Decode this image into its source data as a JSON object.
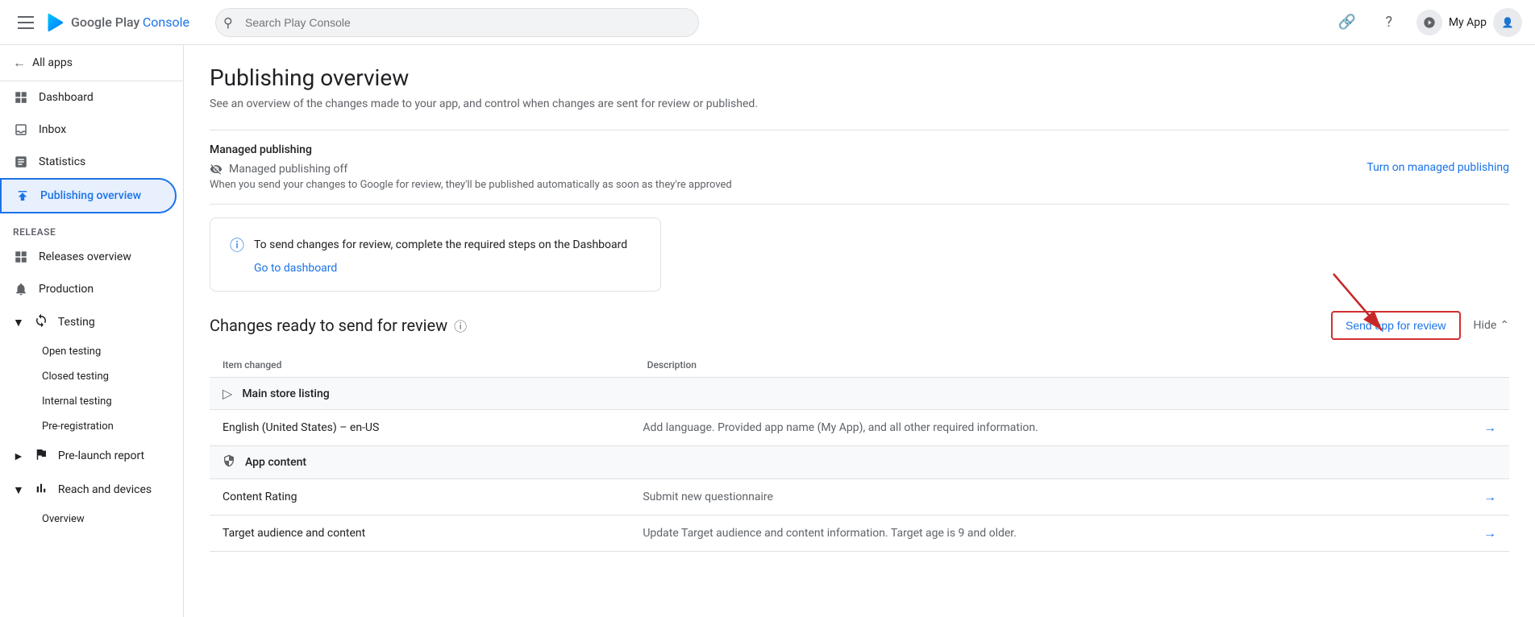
{
  "topbar": {
    "menu_label": "Menu",
    "logo_google": "Google Play",
    "logo_console": "Console",
    "search_placeholder": "Search Play Console",
    "link_icon": "🔗",
    "help_icon": "?",
    "app_name": "My App"
  },
  "sidebar": {
    "all_apps_label": "All apps",
    "nav_items": [
      {
        "id": "dashboard",
        "label": "Dashboard",
        "icon": "grid"
      },
      {
        "id": "inbox",
        "label": "Inbox",
        "icon": "inbox"
      },
      {
        "id": "statistics",
        "label": "Statistics",
        "icon": "bar-chart"
      },
      {
        "id": "publishing-overview",
        "label": "Publishing overview",
        "icon": "publish",
        "active": true
      }
    ],
    "release_section": "Release",
    "release_items": [
      {
        "id": "releases-overview",
        "label": "Releases overview",
        "icon": "grid"
      },
      {
        "id": "production",
        "label": "Production",
        "icon": "bell"
      },
      {
        "id": "testing",
        "label": "Testing",
        "icon": "refresh",
        "expandable": true,
        "expanded": true
      },
      {
        "id": "open-testing",
        "label": "Open testing",
        "sub": true
      },
      {
        "id": "closed-testing",
        "label": "Closed testing",
        "sub": true
      },
      {
        "id": "internal-testing",
        "label": "Internal testing",
        "sub": true
      },
      {
        "id": "pre-registration",
        "label": "Pre-registration",
        "sub": true
      },
      {
        "id": "pre-launch-report",
        "label": "Pre-launch report",
        "icon": "flag",
        "expandable": true
      },
      {
        "id": "reach-and-devices",
        "label": "Reach and devices",
        "icon": "bar-chart",
        "expandable": true,
        "expanded": true
      },
      {
        "id": "overview",
        "label": "Overview",
        "sub": true
      }
    ]
  },
  "page": {
    "title": "Publishing overview",
    "subtitle": "See an overview of the changes made to your app, and control when changes are sent for review or published."
  },
  "managed_publishing": {
    "section_title": "Managed publishing",
    "status_label": "Managed publishing off",
    "description": "When you send your changes to Google for review, they'll be published automatically as soon as they're approved",
    "turn_on_label": "Turn on managed publishing"
  },
  "info_box": {
    "text": "To send changes for review, complete the required steps on the Dashboard",
    "link_label": "Go to dashboard"
  },
  "changes": {
    "title": "Changes ready to send for review",
    "send_review_label": "Send app for review",
    "hide_label": "Hide",
    "col_item": "Item changed",
    "col_description": "Description",
    "sections": [
      {
        "id": "main-store-listing",
        "icon": "▷",
        "label": "Main store listing",
        "rows": [
          {
            "item": "English (United States) – en-US",
            "description": "Add language. Provided app name (My App), and all other required information.",
            "has_arrow": true
          }
        ]
      },
      {
        "id": "app-content",
        "icon": "🛡",
        "label": "App content",
        "rows": [
          {
            "item": "Content Rating",
            "description": "Submit new questionnaire",
            "has_arrow": true
          },
          {
            "item": "Target audience and content",
            "description": "Update Target audience and content information. Target age is 9 and older.",
            "has_arrow": true
          }
        ]
      }
    ]
  }
}
